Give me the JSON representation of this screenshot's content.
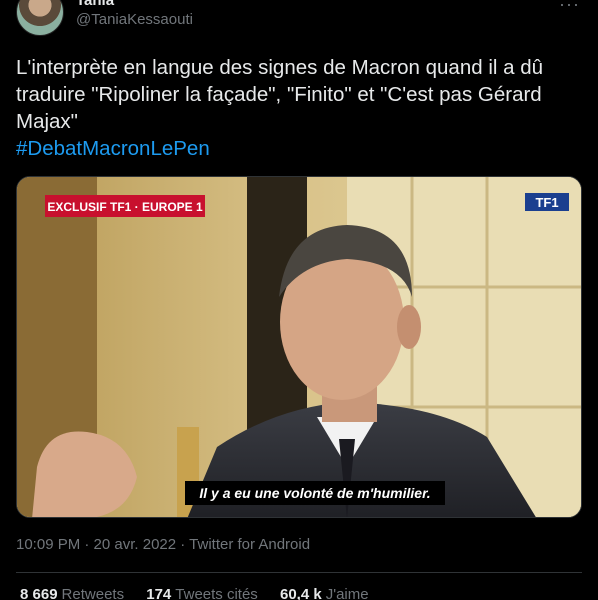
{
  "author": {
    "name": "Tania",
    "handle": "@TaniaKessaouti"
  },
  "tweet": {
    "text": "L'interprète en langue des signes de Macron quand il a dû traduire \"Ripoliner la façade\", \"Finito\" et \"C'est pas Gérard Majax\"",
    "hashtag": "#DebatMacronLePen"
  },
  "media": {
    "banner": "EXCLUSIF TF1 · EUROPE 1",
    "logo": "TF1",
    "subtitle": "Il y a eu une volonté de m'humilier."
  },
  "meta": {
    "timestamp": "10:09 PM · 20 avr. 2022 · Twitter for Android"
  },
  "stats": {
    "retweets_count": "8 669",
    "retweets_label": "Retweets",
    "quotes_count": "174",
    "quotes_label": "Tweets cités",
    "likes_count": "60,4 k",
    "likes_label": "J'aime"
  },
  "colors": {
    "accent": "#1d9bf0",
    "banner_red": "#c8102e",
    "background": "#000000"
  }
}
